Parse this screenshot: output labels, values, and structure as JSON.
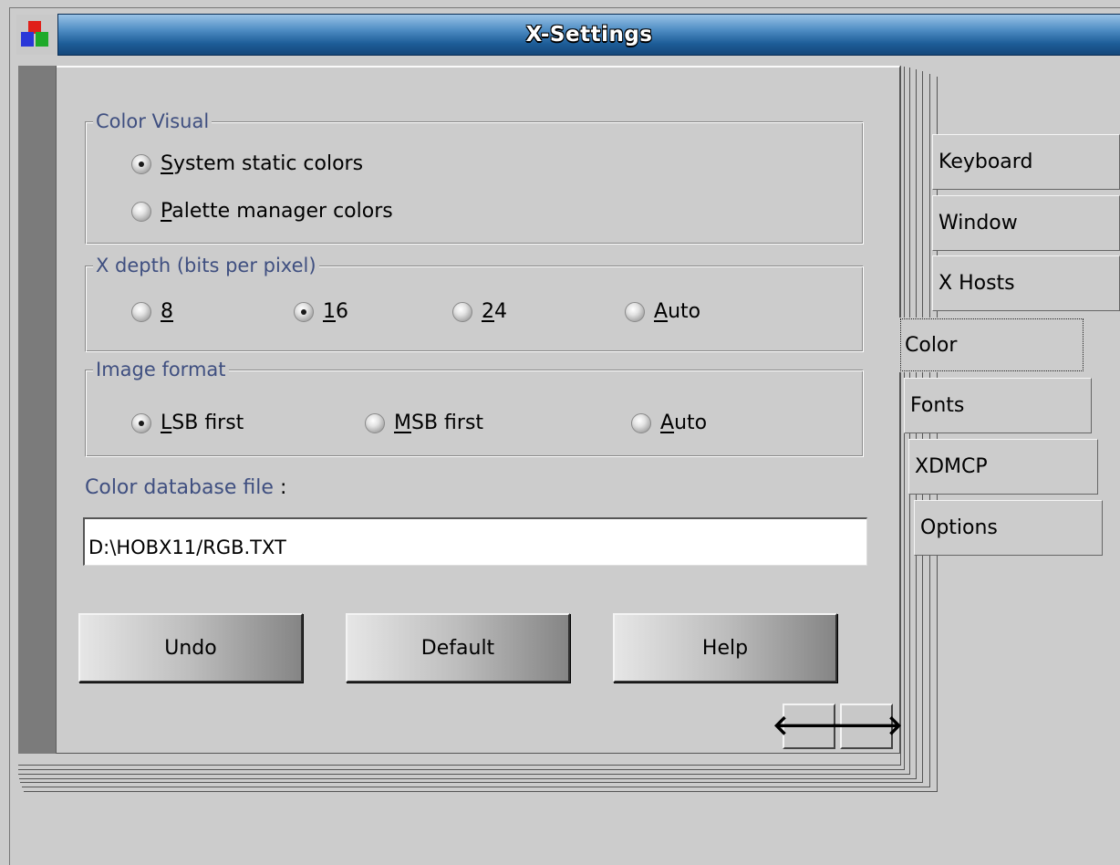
{
  "window": {
    "title": "X-Settings",
    "system_menu_icon": "colored-blocks-icon"
  },
  "tabs": [
    {
      "label": "Keyboard",
      "active": false
    },
    {
      "label": "Window",
      "active": false
    },
    {
      "label": "X Hosts",
      "active": false
    },
    {
      "label": "Color",
      "active": true
    },
    {
      "label": "Fonts",
      "active": false
    },
    {
      "label": "XDMCP",
      "active": false
    },
    {
      "label": "Options",
      "active": false
    }
  ],
  "color_visual": {
    "legend": "Color Visual",
    "options": [
      {
        "mnemonic": "S",
        "rest": "ystem static colors",
        "selected": true
      },
      {
        "mnemonic": "P",
        "rest": "alette manager colors",
        "selected": false
      }
    ]
  },
  "x_depth": {
    "legend": "X depth (bits per pixel)",
    "options": [
      {
        "mnemonic": "8",
        "rest": "",
        "selected": false
      },
      {
        "mnemonic": "1",
        "rest": "6",
        "selected": true
      },
      {
        "mnemonic": "2",
        "rest": "4",
        "selected": false
      },
      {
        "mnemonic": "A",
        "rest": "uto",
        "selected": false
      }
    ]
  },
  "image_format": {
    "legend": "Image format",
    "options": [
      {
        "mnemonic": "L",
        "rest": "SB first",
        "selected": true
      },
      {
        "mnemonic": "M",
        "rest": "SB first",
        "selected": false
      },
      {
        "mnemonic": "A",
        "rest": "uto",
        "selected": false
      }
    ]
  },
  "color_db": {
    "label": "Color database file",
    "separator": ":",
    "value": "D:\\HOBX11/RGB.TXT"
  },
  "buttons": {
    "undo": "Undo",
    "default": "Default",
    "help": "Help"
  },
  "nav": {
    "prev_icon": "arrow-left-icon",
    "next_icon": "arrow-right-icon",
    "prev_glyph": "🡐",
    "next_glyph": "🡒"
  },
  "colors": {
    "titlebar": "#1d5d98",
    "label_text": "#3f4f80",
    "background": "#cccccc"
  }
}
